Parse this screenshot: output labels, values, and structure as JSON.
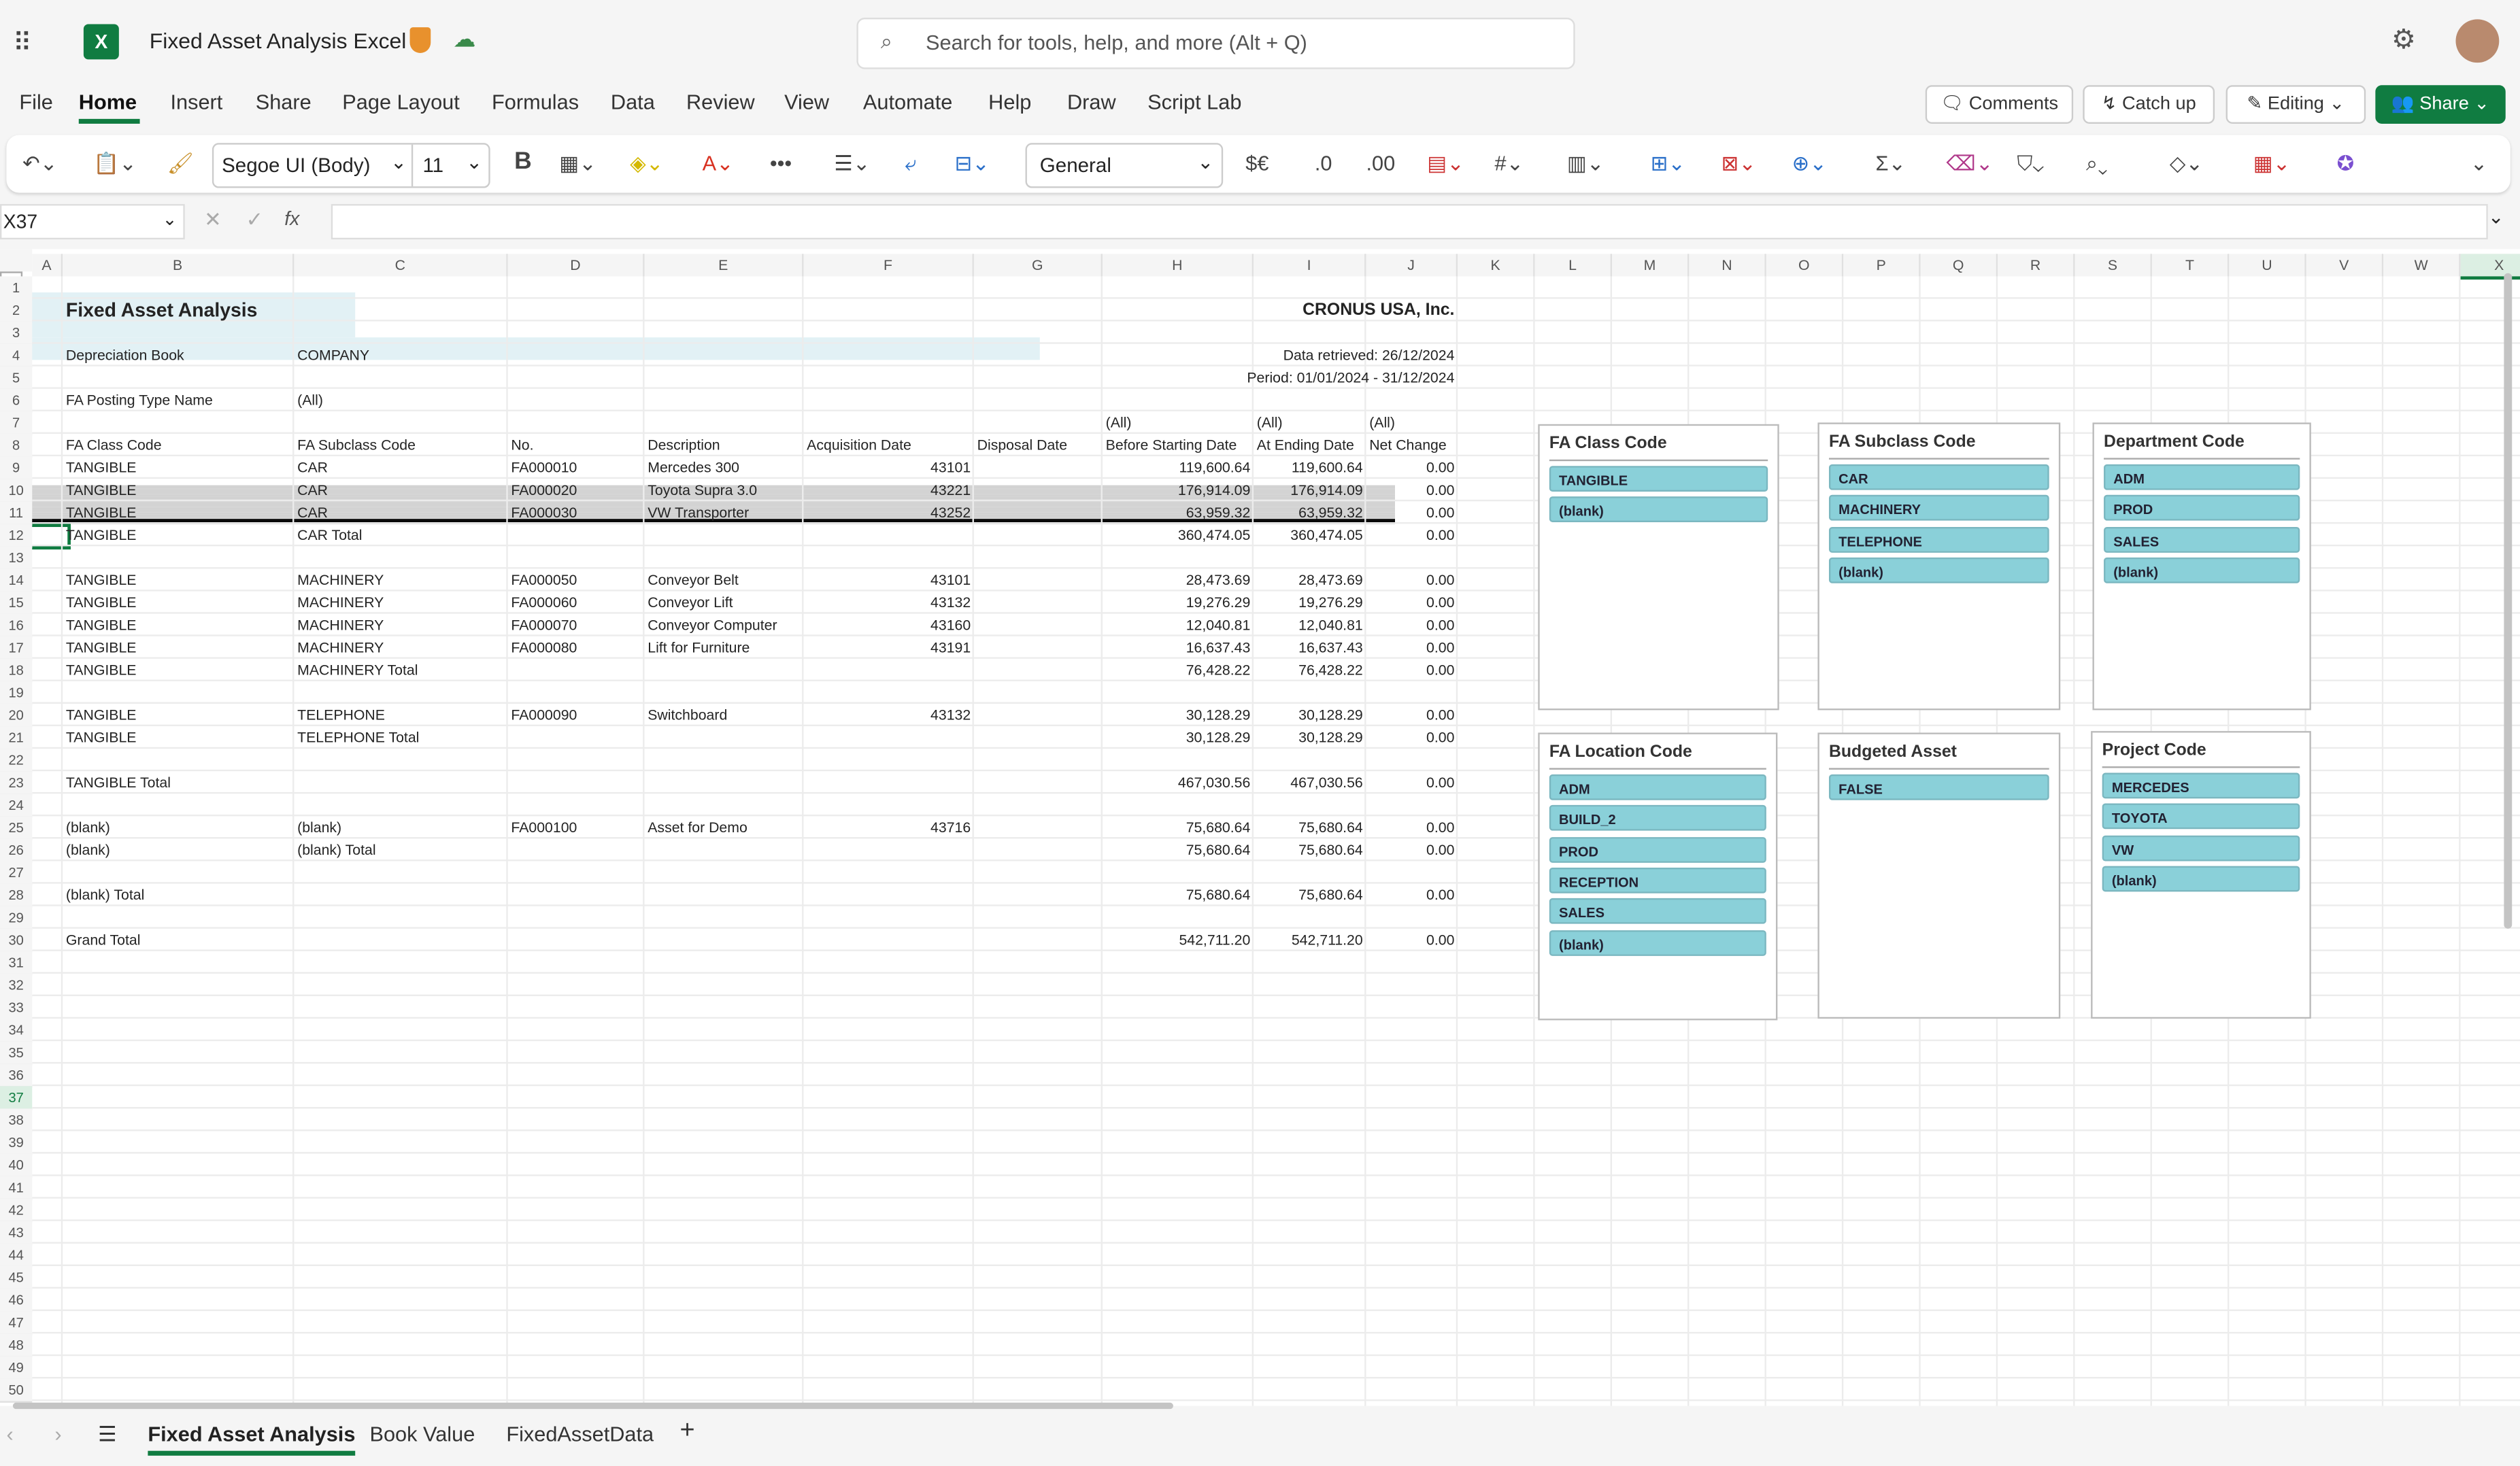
{
  "app": {
    "title": "Fixed Asset Analysis Excel",
    "search_placeholder": "Search for tools, help, and more (Alt + Q)",
    "brand_color": "#107c41"
  },
  "menu": {
    "tabs": [
      "File",
      "Home",
      "Insert",
      "Share",
      "Page Layout",
      "Formulas",
      "Data",
      "Review",
      "View",
      "Automate",
      "Help",
      "Draw",
      "Script Lab"
    ],
    "active": "Home"
  },
  "actions": {
    "comments": "Comments",
    "catch_up": "Catch up",
    "editing": "Editing",
    "share": "Share"
  },
  "toolbar": {
    "font": "Segoe UI (Body)",
    "size": "11",
    "bold": "B",
    "number_format": "General",
    "currency": "$€"
  },
  "formula_bar": {
    "name_box": "X37",
    "fx": "fx",
    "value": ""
  },
  "columns": [
    "A",
    "B",
    "C",
    "D",
    "E",
    "F",
    "G",
    "H",
    "I",
    "J",
    "K",
    "L",
    "M",
    "N",
    "O",
    "P",
    "Q",
    "R",
    "S",
    "T",
    "U",
    "V",
    "W",
    "X"
  ],
  "selected_cell": "X37",
  "report": {
    "title": "Fixed Asset Analysis",
    "company": "CRONUS USA, Inc.",
    "depreciation_book_label": "Depreciation Book",
    "depreciation_book": "COMPANY",
    "data_retrieved": "Data retrieved: 26/12/2024",
    "period": "Period: 01/01/2024 - 31/12/2024",
    "posting_type_label": "FA Posting Type Name",
    "posting_type": "(All)",
    "value_filters": [
      "(All)",
      "(All)",
      "(All)"
    ],
    "headers": [
      "FA Class Code",
      "FA Subclass Code",
      "No.",
      "Description",
      "Acquisition Date",
      "Disposal Date",
      "Before Starting Date",
      "At Ending Date",
      "Net Change"
    ],
    "rows": [
      {
        "r": 9,
        "v": [
          "TANGIBLE",
          "CAR",
          "FA000010",
          "Mercedes 300",
          "43101",
          "",
          "119,600.64",
          "119,600.64",
          "0.00"
        ]
      },
      {
        "r": 10,
        "v": [
          "TANGIBLE",
          "CAR",
          "FA000020",
          "Toyota Supra 3.0",
          "43221",
          "",
          "176,914.09",
          "176,914.09",
          "0.00"
        ]
      },
      {
        "r": 11,
        "v": [
          "TANGIBLE",
          "CAR",
          "FA000030",
          "VW Transporter",
          "43252",
          "",
          "63,959.32",
          "63,959.32",
          "0.00"
        ]
      },
      {
        "r": 12,
        "v": [
          "TANGIBLE",
          "CAR Total",
          "",
          "",
          "",
          "",
          "360,474.05",
          "360,474.05",
          "0.00"
        ]
      },
      {
        "r": 14,
        "v": [
          "TANGIBLE",
          "MACHINERY",
          "FA000050",
          "Conveyor Belt",
          "43101",
          "",
          "28,473.69",
          "28,473.69",
          "0.00"
        ]
      },
      {
        "r": 15,
        "v": [
          "TANGIBLE",
          "MACHINERY",
          "FA000060",
          "Conveyor Lift",
          "43132",
          "",
          "19,276.29",
          "19,276.29",
          "0.00"
        ]
      },
      {
        "r": 16,
        "v": [
          "TANGIBLE",
          "MACHINERY",
          "FA000070",
          "Conveyor Computer",
          "43160",
          "",
          "12,040.81",
          "12,040.81",
          "0.00"
        ]
      },
      {
        "r": 17,
        "v": [
          "TANGIBLE",
          "MACHINERY",
          "FA000080",
          "Lift for Furniture",
          "43191",
          "",
          "16,637.43",
          "16,637.43",
          "0.00"
        ]
      },
      {
        "r": 18,
        "v": [
          "TANGIBLE",
          "MACHINERY Total",
          "",
          "",
          "",
          "",
          "76,428.22",
          "76,428.22",
          "0.00"
        ]
      },
      {
        "r": 20,
        "v": [
          "TANGIBLE",
          "TELEPHONE",
          "FA000090",
          "Switchboard",
          "43132",
          "",
          "30,128.29",
          "30,128.29",
          "0.00"
        ]
      },
      {
        "r": 21,
        "v": [
          "TANGIBLE",
          "TELEPHONE Total",
          "",
          "",
          "",
          "",
          "30,128.29",
          "30,128.29",
          "0.00"
        ]
      },
      {
        "r": 23,
        "v": [
          "TANGIBLE Total",
          "",
          "",
          "",
          "",
          "",
          "467,030.56",
          "467,030.56",
          "0.00"
        ]
      },
      {
        "r": 25,
        "v": [
          "(blank)",
          "(blank)",
          "FA000100",
          "Asset for Demo",
          "43716",
          "",
          "75,680.64",
          "75,680.64",
          "0.00"
        ]
      },
      {
        "r": 26,
        "v": [
          "(blank)",
          "(blank) Total",
          "",
          "",
          "",
          "",
          "75,680.64",
          "75,680.64",
          "0.00"
        ]
      },
      {
        "r": 28,
        "v": [
          "(blank) Total",
          "",
          "",
          "",
          "",
          "",
          "75,680.64",
          "75,680.64",
          "0.00"
        ]
      },
      {
        "r": 30,
        "v": [
          "Grand Total",
          "",
          "",
          "",
          "",
          "",
          "542,711.20",
          "542,711.20",
          "0.00"
        ]
      }
    ]
  },
  "slicers": [
    {
      "title": "FA Class Code",
      "items": [
        "TANGIBLE",
        "(blank)"
      ]
    },
    {
      "title": "FA Subclass Code",
      "items": [
        "CAR",
        "MACHINERY",
        "TELEPHONE",
        "(blank)"
      ]
    },
    {
      "title": "Department Code",
      "items": [
        "ADM",
        "PROD",
        "SALES",
        "(blank)"
      ]
    },
    {
      "title": "FA Location Code",
      "items": [
        "ADM",
        "BUILD_2",
        "PROD",
        "RECEPTION",
        "SALES",
        "(blank)"
      ]
    },
    {
      "title": "Budgeted Asset",
      "items": [
        "FALSE"
      ]
    },
    {
      "title": "Project Code",
      "items": [
        "MERCEDES",
        "TOYOTA",
        "VW",
        "(blank)"
      ]
    }
  ],
  "slicer_color": "#8ad0d9",
  "sheets": {
    "tabs": [
      "Fixed Asset Analysis",
      "Book Value",
      "FixedAssetData"
    ],
    "active": "Fixed Asset Analysis"
  }
}
